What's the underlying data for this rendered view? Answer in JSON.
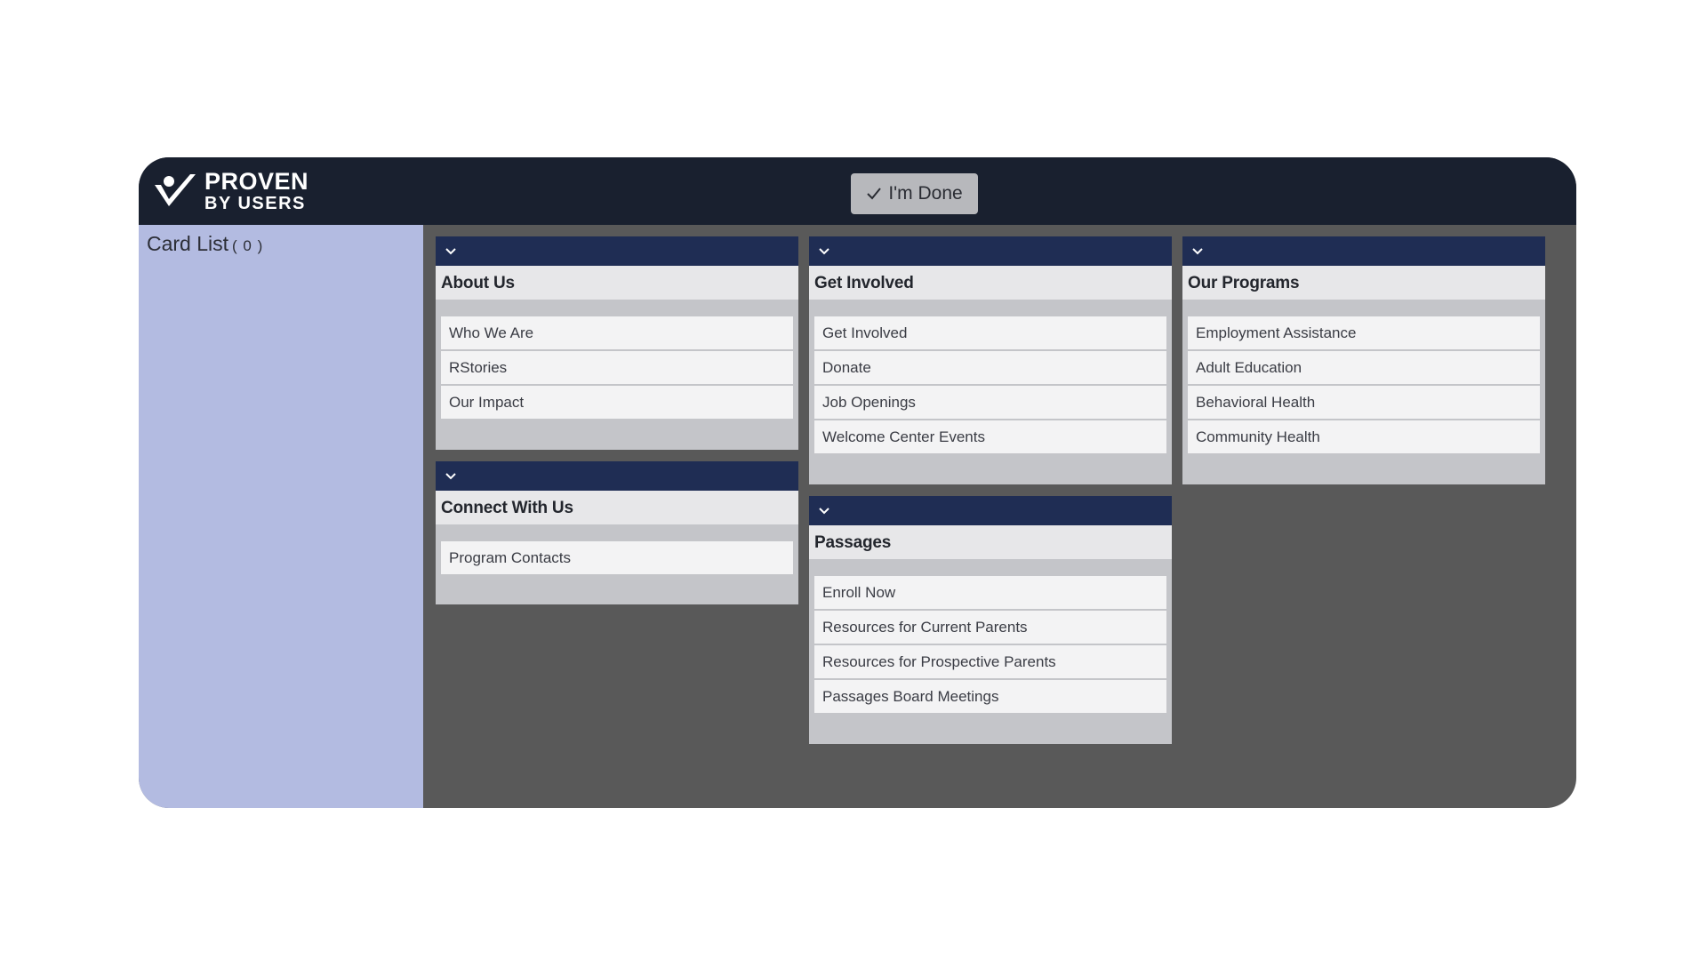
{
  "app": {
    "logo": {
      "line1": "PROVEN",
      "line2": "BY USERS"
    },
    "done_label": "I'm Done"
  },
  "sidebar": {
    "title": "Card List",
    "count": "( 0 )"
  },
  "cards": [
    {
      "title": "About Us",
      "items": [
        "Who We Are",
        "RStories",
        "Our Impact"
      ]
    },
    {
      "title": "Connect With Us",
      "items": [
        "Program Contacts"
      ]
    },
    {
      "title": "Get Involved",
      "items": [
        "Get Involved",
        "Donate",
        "Job Openings",
        "Welcome Center Events"
      ]
    },
    {
      "title": "Passages",
      "items": [
        "Enroll Now",
        "Resources for Current Parents",
        "Resources for Prospective Parents",
        "Passages Board Meetings"
      ]
    },
    {
      "title": "Our Programs",
      "items": [
        "Employment Assistance",
        "Adult Education",
        "Behavioral Health",
        "Community Health"
      ]
    }
  ],
  "icons": {
    "collapse": "chevron-down-icon",
    "done": "check-icon",
    "logo": "checkmark-person-logo"
  },
  "colors": {
    "topbar": "#19202f",
    "sidebar": "#b3bbe1",
    "board": "#595959",
    "card_header": "#1f2d54"
  }
}
